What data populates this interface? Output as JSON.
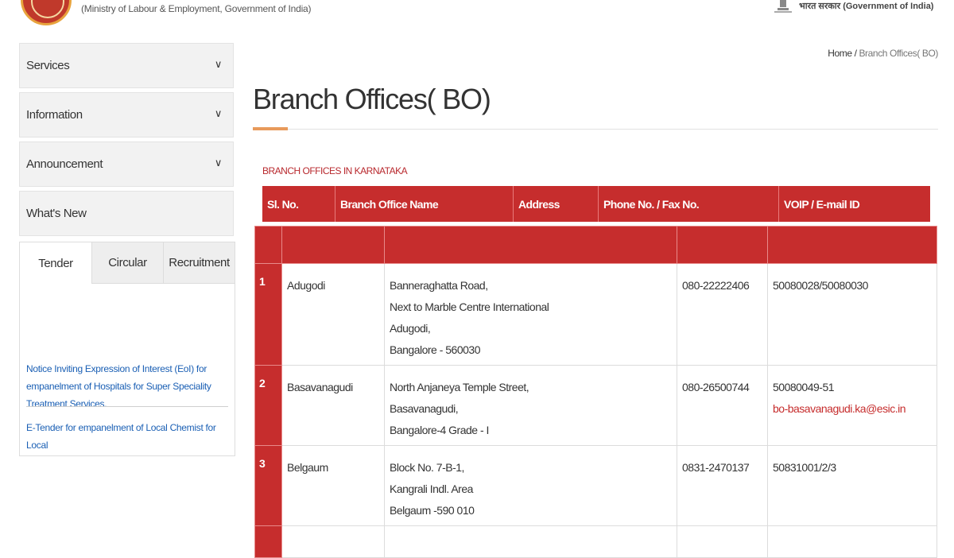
{
  "header": {
    "ministry": "(Ministry of Labour & Employment, Government of India)",
    "govt_label": "भारत सरकार (Government of India)"
  },
  "sidebar": {
    "items": [
      {
        "label": "Services",
        "chevron": "chevron-down-icon"
      },
      {
        "label": "Information",
        "chevron": "chevron-down-icon"
      },
      {
        "label": "Announcement",
        "chevron": "chevron-down-icon"
      },
      {
        "label": "What's New"
      }
    ],
    "tabs": [
      "Tender",
      "Circular",
      "Recruitment"
    ],
    "tender_links": [
      "Notice Inviting Expression of Interest (EoI) for empanelment of Hospitals for Super Speciality Treatment Services.",
      "E-Tender for empanelment of Local Chemist for Local"
    ]
  },
  "breadcrumb": {
    "home": "Home",
    "separator": " / ",
    "current": "Branch Offices( BO)"
  },
  "page": {
    "title": "Branch Offices( BO)",
    "section": "BRANCH OFFICES IN KARNATAKA"
  },
  "table": {
    "headers": [
      "Sl. No.",
      "Branch Office Name",
      "Address",
      "Phone No. / Fax No.",
      "VOIP / E-mail ID"
    ],
    "rows": [
      {
        "sl": "1",
        "name": "Adugodi",
        "address": [
          "Banneraghatta Road,",
          "Next to Marble Centre International",
          "Adugodi,",
          "Bangalore - 560030"
        ],
        "phone": "080-22222406",
        "voip": "50080028/50080030",
        "email": ""
      },
      {
        "sl": "2",
        "name": "Basavanagudi",
        "address": [
          "North Anjaneya Temple Street,",
          "Basavanagudi,",
          "Bangalore-4 Grade - I"
        ],
        "phone": "080-26500744",
        "voip": "50080049-51",
        "email": "bo-basavanagudi.ka@esic.in"
      },
      {
        "sl": "3",
        "name": "Belgaum",
        "address": [
          "Block No. 7-B-1,",
          "Kangrali Indl. Area",
          "Belgaum -590 010"
        ],
        "phone": "0831-2470137",
        "voip": "50831001/2/3",
        "email": ""
      }
    ]
  },
  "colors": {
    "accent_red": "#c62d2d",
    "link_blue": "#1a5fb4",
    "title_accent": "#e89a5b"
  }
}
